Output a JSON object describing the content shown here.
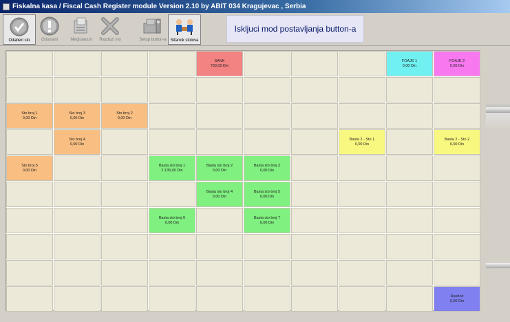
{
  "window": {
    "title": "Fiskalna kasa / Fiscal Cash Register module Version 2.10 by ABIT 034  Kragujevac , Serbia"
  },
  "toolbar": {
    "buttons": [
      {
        "label": "Odaberi sto",
        "icon": "check-icon"
      },
      {
        "label": "Odustani",
        "icon": "exclamation-icon"
      },
      {
        "label": "Medjuracun",
        "icon": "receipt-icon"
      },
      {
        "label": "Razduzi sto",
        "icon": "close-icon"
      },
      {
        "label": "Setup button-a",
        "icon": "setup-icon"
      },
      {
        "label": "Sifarnik stolova",
        "icon": "users-icon"
      }
    ],
    "mode_label": "Iskljuci mod postavljanja button-a"
  },
  "tables": [
    {
      "name": "SANK",
      "value": "700,00 Din",
      "color": "#f38282",
      "row": 0,
      "col": 4
    },
    {
      "name": "FOAJE 1",
      "value": "0,00 Din",
      "color": "#70f0f0",
      "row": 0,
      "col": 8
    },
    {
      "name": "FOAJE 2",
      "value": "0,00 Din",
      "color": "#f878f0",
      "row": 0,
      "col": 9
    },
    {
      "name": "Sto broj 1",
      "value": "0,00 Din",
      "color": "#f8be82",
      "row": 2,
      "col": 0
    },
    {
      "name": "Sto broj 3",
      "value": "0,00 Din",
      "color": "#f8be82",
      "row": 2,
      "col": 1
    },
    {
      "name": "Sto broj 2",
      "value": "0,00 Din",
      "color": "#f8be82",
      "row": 2,
      "col": 2
    },
    {
      "name": "Sto broj 4",
      "value": "0,00 Din",
      "color": "#f8be82",
      "row": 3,
      "col": 1
    },
    {
      "name": "Basta 2 - Sto 1",
      "value": "0,00 Din",
      "color": "#f8f880",
      "row": 3,
      "col": 7
    },
    {
      "name": "Basta 2 - Sto 2",
      "value": "0,00 Din",
      "color": "#f8f880",
      "row": 3,
      "col": 9
    },
    {
      "name": "Sto broj 5",
      "value": "0,00 Din",
      "color": "#f8be82",
      "row": 4,
      "col": 0
    },
    {
      "name": "Basta sto broj 1",
      "value": "2.135,00 Din",
      "color": "#80f080",
      "row": 4,
      "col": 3
    },
    {
      "name": "Basta sto broj 2",
      "value": "0,00 Din",
      "color": "#80f080",
      "row": 4,
      "col": 4
    },
    {
      "name": "Basta sto broj 3",
      "value": "0,00 Din",
      "color": "#80f080",
      "row": 4,
      "col": 5
    },
    {
      "name": "Basta sto broj 4",
      "value": "0,00 Din",
      "color": "#80f080",
      "row": 5,
      "col": 4
    },
    {
      "name": "Basta sto broj 5",
      "value": "0,00 Din",
      "color": "#80f080",
      "row": 5,
      "col": 5
    },
    {
      "name": "Basta sto broj 6",
      "value": "0,00 Din",
      "color": "#80f080",
      "row": 6,
      "col": 3
    },
    {
      "name": "Basta sto broj 7",
      "value": "0,00 Din",
      "color": "#80f080",
      "row": 6,
      "col": 5
    },
    {
      "name": "Rashod",
      "value": "0,00 Din",
      "color": "#8080f0",
      "row": 9,
      "col": 9
    }
  ],
  "grid": {
    "rows": 10,
    "cols": 10
  }
}
